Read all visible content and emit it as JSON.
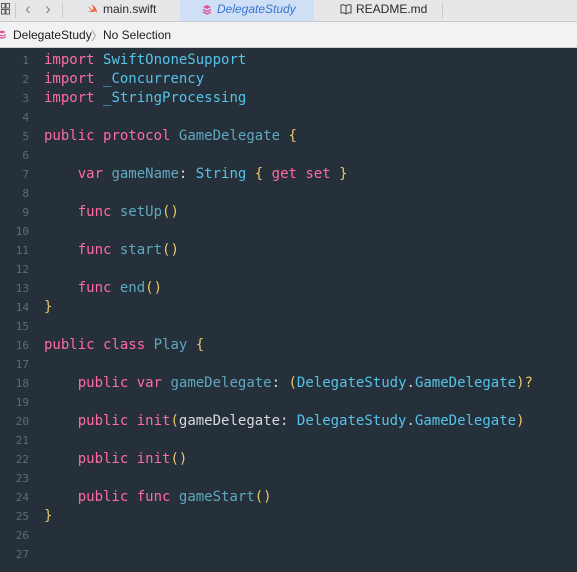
{
  "tabs": [
    {
      "label": "main.swift",
      "icon": "swift-icon"
    },
    {
      "label": "DelegateStudy",
      "icon": "swift-interface-icon",
      "active": true
    },
    {
      "label": "README.md",
      "icon": "book-icon"
    }
  ],
  "breadcrumb": {
    "project": "DelegateStudy",
    "selection": "No Selection"
  },
  "colors": {
    "editor_bg": "#26303a",
    "keyword": "#ff6ba0",
    "type": "#55c3e8",
    "identifier": "#5fa8bf",
    "punctuation": "#e7c86c",
    "active_tab_bg": "#cfdff6",
    "active_tab_text": "#3774cf"
  },
  "code": [
    [
      [
        "kw",
        "import"
      ],
      [
        "df",
        " "
      ],
      [
        "ty",
        "SwiftOnoneSupport"
      ]
    ],
    [
      [
        "kw",
        "import"
      ],
      [
        "df",
        " "
      ],
      [
        "ty",
        "_Concurrency"
      ]
    ],
    [
      [
        "kw",
        "import"
      ],
      [
        "df",
        " "
      ],
      [
        "ty",
        "_StringProcessing"
      ]
    ],
    [],
    [
      [
        "kw",
        "public"
      ],
      [
        "df",
        " "
      ],
      [
        "kw",
        "protocol"
      ],
      [
        "df",
        " "
      ],
      [
        "pr",
        "GameDelegate"
      ],
      [
        "df",
        " "
      ],
      [
        "pu",
        "{"
      ]
    ],
    [],
    [
      [
        "df",
        "    "
      ],
      [
        "kw",
        "var"
      ],
      [
        "df",
        " "
      ],
      [
        "pr",
        "gameName"
      ],
      [
        "df",
        ": "
      ],
      [
        "ty",
        "String"
      ],
      [
        "df",
        " "
      ],
      [
        "pu",
        "{"
      ],
      [
        "df",
        " "
      ],
      [
        "kw",
        "get"
      ],
      [
        "df",
        " "
      ],
      [
        "kw",
        "set"
      ],
      [
        "df",
        " "
      ],
      [
        "pu",
        "}"
      ]
    ],
    [],
    [
      [
        "df",
        "    "
      ],
      [
        "kw",
        "func"
      ],
      [
        "df",
        " "
      ],
      [
        "pr",
        "setUp"
      ],
      [
        "pu",
        "()"
      ]
    ],
    [],
    [
      [
        "df",
        "    "
      ],
      [
        "kw",
        "func"
      ],
      [
        "df",
        " "
      ],
      [
        "pr",
        "start"
      ],
      [
        "pu",
        "()"
      ]
    ],
    [],
    [
      [
        "df",
        "    "
      ],
      [
        "kw",
        "func"
      ],
      [
        "df",
        " "
      ],
      [
        "pr",
        "end"
      ],
      [
        "pu",
        "()"
      ]
    ],
    [
      [
        "pu",
        "}"
      ]
    ],
    [],
    [
      [
        "kw",
        "public"
      ],
      [
        "df",
        " "
      ],
      [
        "kw",
        "class"
      ],
      [
        "df",
        " "
      ],
      [
        "pr",
        "Play"
      ],
      [
        "df",
        " "
      ],
      [
        "pu",
        "{"
      ]
    ],
    [],
    [
      [
        "df",
        "    "
      ],
      [
        "kw",
        "public"
      ],
      [
        "df",
        " "
      ],
      [
        "kw",
        "var"
      ],
      [
        "df",
        " "
      ],
      [
        "pr",
        "gameDelegate"
      ],
      [
        "df",
        ": "
      ],
      [
        "pu",
        "("
      ],
      [
        "ty",
        "DelegateStudy"
      ],
      [
        "df",
        "."
      ],
      [
        "ty",
        "GameDelegate"
      ],
      [
        "pu",
        ")?"
      ]
    ],
    [],
    [
      [
        "df",
        "    "
      ],
      [
        "kw",
        "public"
      ],
      [
        "df",
        " "
      ],
      [
        "kw",
        "init"
      ],
      [
        "pu",
        "("
      ],
      [
        "df",
        "gameDelegate: "
      ],
      [
        "ty",
        "DelegateStudy"
      ],
      [
        "df",
        "."
      ],
      [
        "ty",
        "GameDelegate"
      ],
      [
        "pu",
        ")"
      ]
    ],
    [],
    [
      [
        "df",
        "    "
      ],
      [
        "kw",
        "public"
      ],
      [
        "df",
        " "
      ],
      [
        "kw",
        "init"
      ],
      [
        "pu",
        "()"
      ]
    ],
    [],
    [
      [
        "df",
        "    "
      ],
      [
        "kw",
        "public"
      ],
      [
        "df",
        " "
      ],
      [
        "kw",
        "func"
      ],
      [
        "df",
        " "
      ],
      [
        "pr",
        "gameStart"
      ],
      [
        "pu",
        "()"
      ]
    ],
    [
      [
        "pu",
        "}"
      ]
    ],
    [],
    []
  ]
}
